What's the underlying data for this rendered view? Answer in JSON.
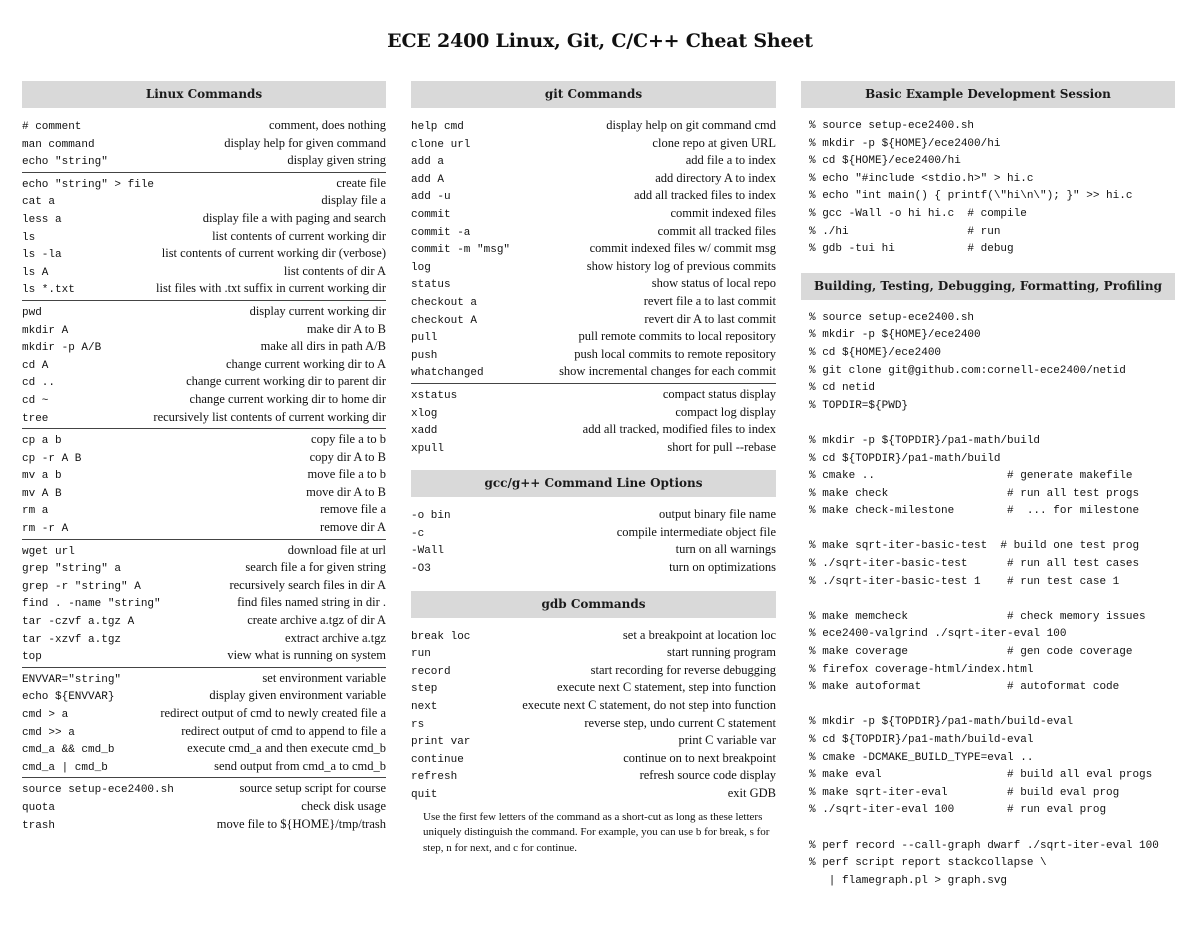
{
  "title": "ECE 2400 Linux, Git, C/C++ Cheat Sheet",
  "linux": {
    "header": "Linux Commands",
    "groups": [
      [
        {
          "cmd": "# comment",
          "desc": "comment, does nothing"
        },
        {
          "cmd": "man command",
          "desc": "display help for given command"
        },
        {
          "cmd": "echo \"string\"",
          "desc": "display given string"
        }
      ],
      [
        {
          "cmd": "echo \"string\" > file",
          "desc": "create file"
        },
        {
          "cmd": "cat a",
          "desc": "display file a"
        },
        {
          "cmd": "less a",
          "desc": "display file a with paging and search"
        },
        {
          "cmd": "ls",
          "desc": "list contents of current working dir"
        },
        {
          "cmd": "ls -la",
          "desc": "list contents of current working dir (verbose)"
        },
        {
          "cmd": "ls A",
          "desc": "list contents of dir A"
        },
        {
          "cmd": "ls *.txt",
          "desc": "list files with .txt suffix in current working dir"
        }
      ],
      [
        {
          "cmd": "pwd",
          "desc": "display current working dir"
        },
        {
          "cmd": "mkdir A",
          "desc": "make dir A to B"
        },
        {
          "cmd": "mkdir -p A/B",
          "desc": "make all dirs in path A/B"
        },
        {
          "cmd": "cd A",
          "desc": "change current working dir to A"
        },
        {
          "cmd": "cd ..",
          "desc": "change current working dir to parent dir"
        },
        {
          "cmd": "cd ~",
          "desc": "change current working dir to home dir"
        },
        {
          "cmd": "tree",
          "desc": "recursively list contents of current working dir"
        }
      ],
      [
        {
          "cmd": "cp a b",
          "desc": "copy file a to b"
        },
        {
          "cmd": "cp -r A B",
          "desc": "copy dir A to B"
        },
        {
          "cmd": "mv a b",
          "desc": "move file a to b"
        },
        {
          "cmd": "mv A B",
          "desc": "move dir A to B"
        },
        {
          "cmd": "rm a",
          "desc": "remove file a"
        },
        {
          "cmd": "rm -r A",
          "desc": "remove dir A"
        }
      ],
      [
        {
          "cmd": "wget url",
          "desc": "download file at url"
        },
        {
          "cmd": "grep \"string\" a",
          "desc": "search file a for given string"
        },
        {
          "cmd": "grep -r \"string\" A",
          "desc": "recursively search files in dir A"
        },
        {
          "cmd": "find . -name \"string\"",
          "desc": "find files named string in dir ."
        },
        {
          "cmd": "tar -czvf a.tgz A",
          "desc": "create archive a.tgz of dir A"
        },
        {
          "cmd": "tar -xzvf a.tgz",
          "desc": "extract archive a.tgz"
        },
        {
          "cmd": "top",
          "desc": "view what is running on system"
        }
      ],
      [
        {
          "cmd": "ENVVAR=\"string\"",
          "desc": "set environment variable"
        },
        {
          "cmd": "echo ${ENVVAR}",
          "desc": "display given environment variable"
        },
        {
          "cmd": "cmd > a",
          "desc": "redirect output of cmd to newly created file a"
        },
        {
          "cmd": "cmd >> a",
          "desc": "redirect output of cmd to append to file a"
        },
        {
          "cmd": "cmd_a && cmd_b",
          "desc": "execute cmd_a and then execute cmd_b"
        },
        {
          "cmd": "cmd_a | cmd_b",
          "desc": "send output from cmd_a to cmd_b"
        }
      ],
      [
        {
          "cmd": "source setup-ece2400.sh",
          "desc": "source setup script for course"
        },
        {
          "cmd": "quota",
          "desc": "check disk usage"
        },
        {
          "cmd": "trash",
          "desc": "move file to ${HOME}/tmp/trash"
        }
      ]
    ]
  },
  "git": {
    "header": "git Commands",
    "groups": [
      [
        {
          "cmd": "help cmd",
          "desc": "display help on git command cmd"
        },
        {
          "cmd": "clone url",
          "desc": "clone repo at given URL"
        },
        {
          "cmd": "add a",
          "desc": "add file a to index"
        },
        {
          "cmd": "add A",
          "desc": "add directory A to index"
        },
        {
          "cmd": "add -u",
          "desc": "add all tracked files to index"
        },
        {
          "cmd": "commit",
          "desc": "commit indexed files"
        },
        {
          "cmd": "commit -a",
          "desc": "commit all tracked files"
        },
        {
          "cmd": "commit -m \"msg\"",
          "desc": "commit indexed files w/ commit msg"
        },
        {
          "cmd": "log",
          "desc": "show history log of previous commits"
        },
        {
          "cmd": "status",
          "desc": "show status of local repo"
        },
        {
          "cmd": "checkout a",
          "desc": "revert file a to last commit"
        },
        {
          "cmd": "checkout A",
          "desc": "revert dir A to last commit"
        },
        {
          "cmd": "pull",
          "desc": "pull remote commits to local repository"
        },
        {
          "cmd": "push",
          "desc": "push local commits to remote repository"
        },
        {
          "cmd": "whatchanged",
          "desc": "show incremental changes for each commit"
        }
      ],
      [
        {
          "cmd": "xstatus",
          "desc": "compact status display"
        },
        {
          "cmd": "xlog",
          "desc": "compact log display"
        },
        {
          "cmd": "xadd",
          "desc": "add all tracked, modified files to index"
        },
        {
          "cmd": "xpull",
          "desc": "short for pull --rebase"
        }
      ]
    ]
  },
  "gcc": {
    "header": "gcc/g++ Command Line Options",
    "rows": [
      {
        "cmd": "-o bin",
        "desc": "output binary file name"
      },
      {
        "cmd": "-c",
        "desc": "compile intermediate object file"
      },
      {
        "cmd": "-Wall",
        "desc": "turn on all warnings"
      },
      {
        "cmd": "-O3",
        "desc": "turn on optimizations"
      }
    ]
  },
  "gdb": {
    "header": "gdb Commands",
    "rows": [
      {
        "cmd": "break loc",
        "desc": "set a breakpoint at location loc"
      },
      {
        "cmd": "run",
        "desc": "start running program"
      },
      {
        "cmd": "record",
        "desc": "start recording for reverse debugging"
      },
      {
        "cmd": "step",
        "desc": "execute next C statement, step into function"
      },
      {
        "cmd": "next",
        "desc": "execute next C statement, do not step into function"
      },
      {
        "cmd": "rs",
        "desc": "reverse step, undo current C statement"
      },
      {
        "cmd": "print var",
        "desc": "print C variable var"
      },
      {
        "cmd": "continue",
        "desc": "continue on to next breakpoint"
      },
      {
        "cmd": "refresh",
        "desc": "refresh source code display"
      },
      {
        "cmd": "quit",
        "desc": "exit GDB"
      }
    ],
    "note": "Use the first few letters of the command as a short-cut as long as these letters uniquely distinguish the command. For example, you can use b for break, s for step, n for next, and c for continue."
  },
  "session": {
    "header": "Basic Example Development Session",
    "lines": [
      "% source setup-ece2400.sh",
      "% mkdir -p ${HOME}/ece2400/hi",
      "% cd ${HOME}/ece2400/hi",
      "% echo \"#include <stdio.h>\" > hi.c",
      "% echo \"int main() { printf(\\\"hi\\n\\\"); }\" >> hi.c",
      "% gcc -Wall -o hi hi.c  # compile",
      "% ./hi                  # run",
      "% gdb -tui hi           # debug"
    ]
  },
  "building": {
    "header": "Building, Testing, Debugging, Formatting, Profiling",
    "lines": [
      "% source setup-ece2400.sh",
      "% mkdir -p ${HOME}/ece2400",
      "% cd ${HOME}/ece2400",
      "% git clone git@github.com:cornell-ece2400/netid",
      "% cd netid",
      "% TOPDIR=${PWD}",
      "",
      "% mkdir -p ${TOPDIR}/pa1-math/build",
      "% cd ${TOPDIR}/pa1-math/build",
      "% cmake ..                    # generate makefile",
      "% make check                  # run all test progs",
      "% make check-milestone        #  ... for milestone",
      "",
      "% make sqrt-iter-basic-test  # build one test prog",
      "% ./sqrt-iter-basic-test      # run all test cases",
      "% ./sqrt-iter-basic-test 1    # run test case 1",
      "",
      "% make memcheck               # check memory issues",
      "% ece2400-valgrind ./sqrt-iter-eval 100",
      "% make coverage               # gen code coverage",
      "% firefox coverage-html/index.html",
      "% make autoformat             # autoformat code",
      "",
      "% mkdir -p ${TOPDIR}/pa1-math/build-eval",
      "% cd ${TOPDIR}/pa1-math/build-eval",
      "% cmake -DCMAKE_BUILD_TYPE=eval ..",
      "% make eval                   # build all eval progs",
      "% make sqrt-iter-eval         # build eval prog",
      "% ./sqrt-iter-eval 100        # run eval prog",
      "",
      "% perf record --call-graph dwarf ./sqrt-iter-eval 100",
      "% perf script report stackcollapse \\",
      "   | flamegraph.pl > graph.svg"
    ]
  }
}
